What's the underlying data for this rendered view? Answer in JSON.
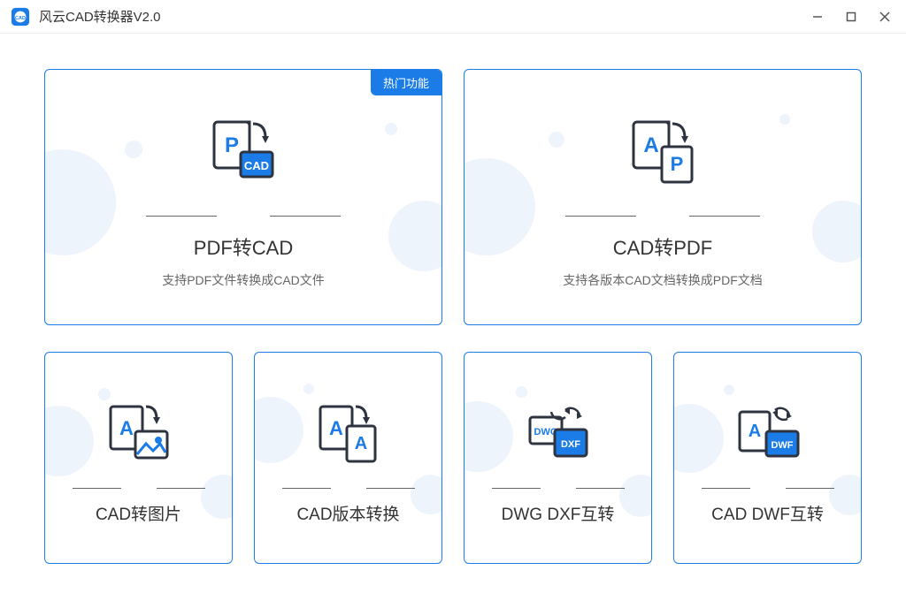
{
  "app": {
    "title": "风云CAD转换器V2.0"
  },
  "top_cards": [
    {
      "title": "PDF转CAD",
      "subtitle": "支持PDF文件转换成CAD文件",
      "badge": "热门功能"
    },
    {
      "title": "CAD转PDF",
      "subtitle": "支持各版本CAD文档转换成PDF文档"
    }
  ],
  "bottom_cards": [
    {
      "title": "CAD转图片"
    },
    {
      "title": "CAD版本转换"
    },
    {
      "title": "DWG DXF互转"
    },
    {
      "title": "CAD DWF互转"
    }
  ]
}
